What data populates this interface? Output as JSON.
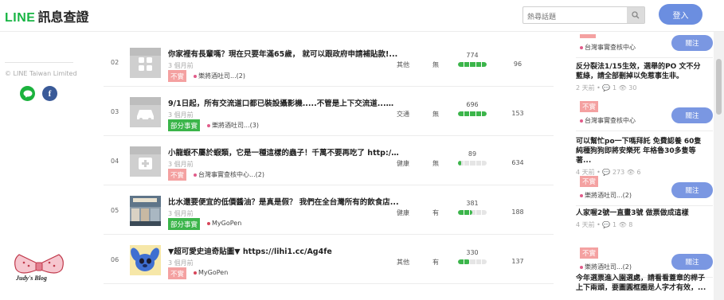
{
  "header": {
    "brand_line": "LINE",
    "brand_cn": "訊息查證",
    "search_placeholder": "熱尋話題",
    "login_label": "登入",
    "search_icon": "search-icon"
  },
  "sidebar_left": {
    "copyright": "© LINE Taiwan Limited",
    "social": [
      "line-icon",
      "facebook-icon"
    ],
    "blog_text": "Judy's Blog"
  },
  "rows": [
    {
      "rank": "02",
      "title": "你家裡有長輩嗎？現在只要年滿65歲， 就可以跟政府申請補貼款!...",
      "time": "3 個月前",
      "badge": "不實",
      "badge_type": "red",
      "author": "樂將酒吐司...(2)",
      "category": "其他",
      "flag": "無",
      "bar_value": "774",
      "bar_fill": 1.0,
      "count": "96",
      "thumb": "apps"
    },
    {
      "rank": "03",
      "title": "9/1日起，所有交流道口都已裝設攝影機.....不管是上下交流道...只...",
      "time": "3 個月前",
      "badge": "部分事實",
      "badge_type": "green",
      "author": "樂將酒吐司...(3)",
      "category": "交通",
      "flag": "無",
      "bar_value": "696",
      "bar_fill": 1.0,
      "count": "153",
      "thumb": "car"
    },
    {
      "rank": "04",
      "title": "小龍蝦不屬於蝦類，它是一種這樣的蟲子！千萬不要再吃了 http:/...",
      "time": "3 個月前",
      "badge": "不實",
      "badge_type": "red",
      "author": "台灣事實查核中心...(2)",
      "category": "健康",
      "flag": "無",
      "bar_value": "89",
      "bar_fill": 0.12,
      "count": "634",
      "thumb": "medical"
    },
    {
      "rank": "05",
      "title": "比水還要便宜的低價醬油？是真是假？ 我們在全台灣所有的飲食店...",
      "time": "3 個月前",
      "badge": "部分事實",
      "badge_type": "green",
      "author": "MyGoPen",
      "category": "健康",
      "flag": "有",
      "bar_value": "381",
      "bar_fill": 0.49,
      "count": "188",
      "thumb": "store"
    },
    {
      "rank": "06",
      "title": "▼超可愛史迪奇貼圖▼ https://lihi1.cc/Ag4fe",
      "time": "3 個月前",
      "badge": "不實",
      "badge_type": "red",
      "author": "MyGoPen",
      "category": "其他",
      "flag": "有",
      "bar_value": "330",
      "bar_fill": 0.43,
      "count": "137",
      "thumb": "stitch"
    }
  ],
  "right_cards": [
    {
      "title": "",
      "meta": "",
      "badge": "",
      "author": "台灣事實查核中心",
      "follow": "關注"
    },
    {
      "title": "反分裂法1/15生效，選舉的PO 文不分藍綠，請全部刪掉以免惹事生非。",
      "meta": "2 天前 • 💬 1 👁 30",
      "badge": "不實",
      "author": "台灣事實查核中心",
      "follow": "關注"
    },
    {
      "title": "可以幫忙po一下嗎拜託 免費認養 60隻純種狗狗即將安樂死 年格魯30多隻等著...",
      "meta": "4 天前 • 💬 273 👁 6",
      "badge": "不實",
      "author": "樂將酒吐司...(2)",
      "follow": "關注"
    },
    {
      "title": "人家喔2號一直畫3號 做票做成這樣",
      "meta": "4 天前 • 💬 1 👁 8",
      "badge": "不實",
      "author": "樂將酒吐司...(2)",
      "follow": "關注"
    },
    {
      "title": "今年選票進入園選處，請看看蓋章的桿子上下兩頭，要圖圓框圈是人字才有效，...",
      "meta": "",
      "badge": "",
      "author": "",
      "follow": ""
    }
  ]
}
